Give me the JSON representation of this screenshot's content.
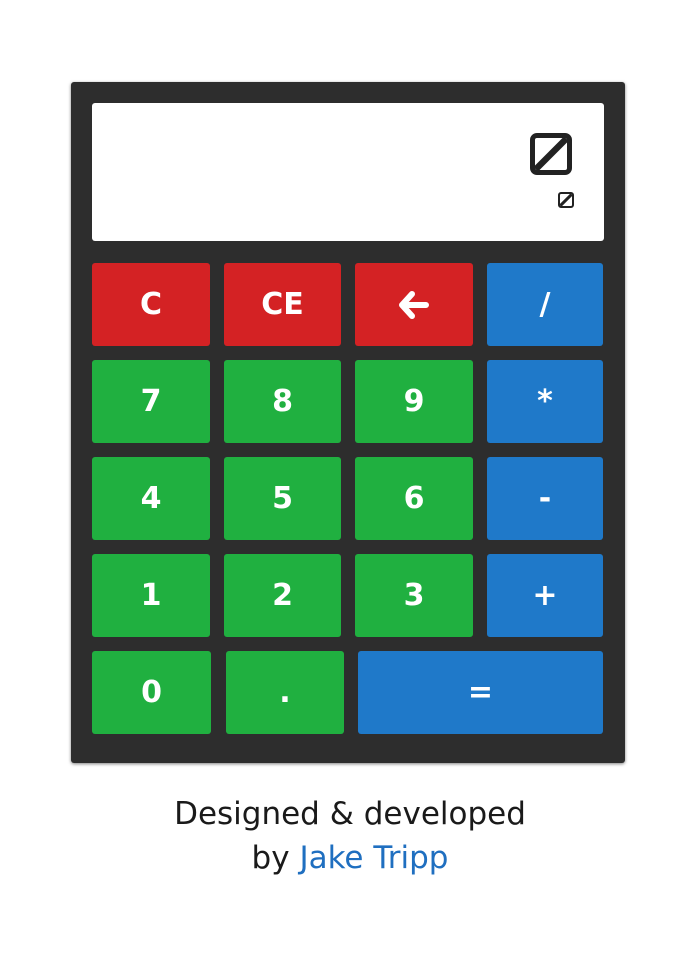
{
  "display": {
    "main_icon": "missing-glyph-icon",
    "sub_icon": "missing-glyph-icon"
  },
  "buttons": {
    "clear": "C",
    "clear_entry": "CE",
    "backspace_icon": "arrow-left-icon",
    "divide": "/",
    "seven": "7",
    "eight": "8",
    "nine": "9",
    "multiply": "*",
    "four": "4",
    "five": "5",
    "six": "6",
    "subtract": "-",
    "one": "1",
    "two": "2",
    "three": "3",
    "add": "+",
    "zero": "0",
    "decimal": ".",
    "equals": "="
  },
  "footer": {
    "line1": "Designed & developed",
    "by": "by",
    "author": "Jake Tripp"
  },
  "colors": {
    "panel": "#2d2d2d",
    "red": "#d42224",
    "green": "#20b040",
    "blue": "#1f79c9",
    "link": "#1f6fc0"
  }
}
